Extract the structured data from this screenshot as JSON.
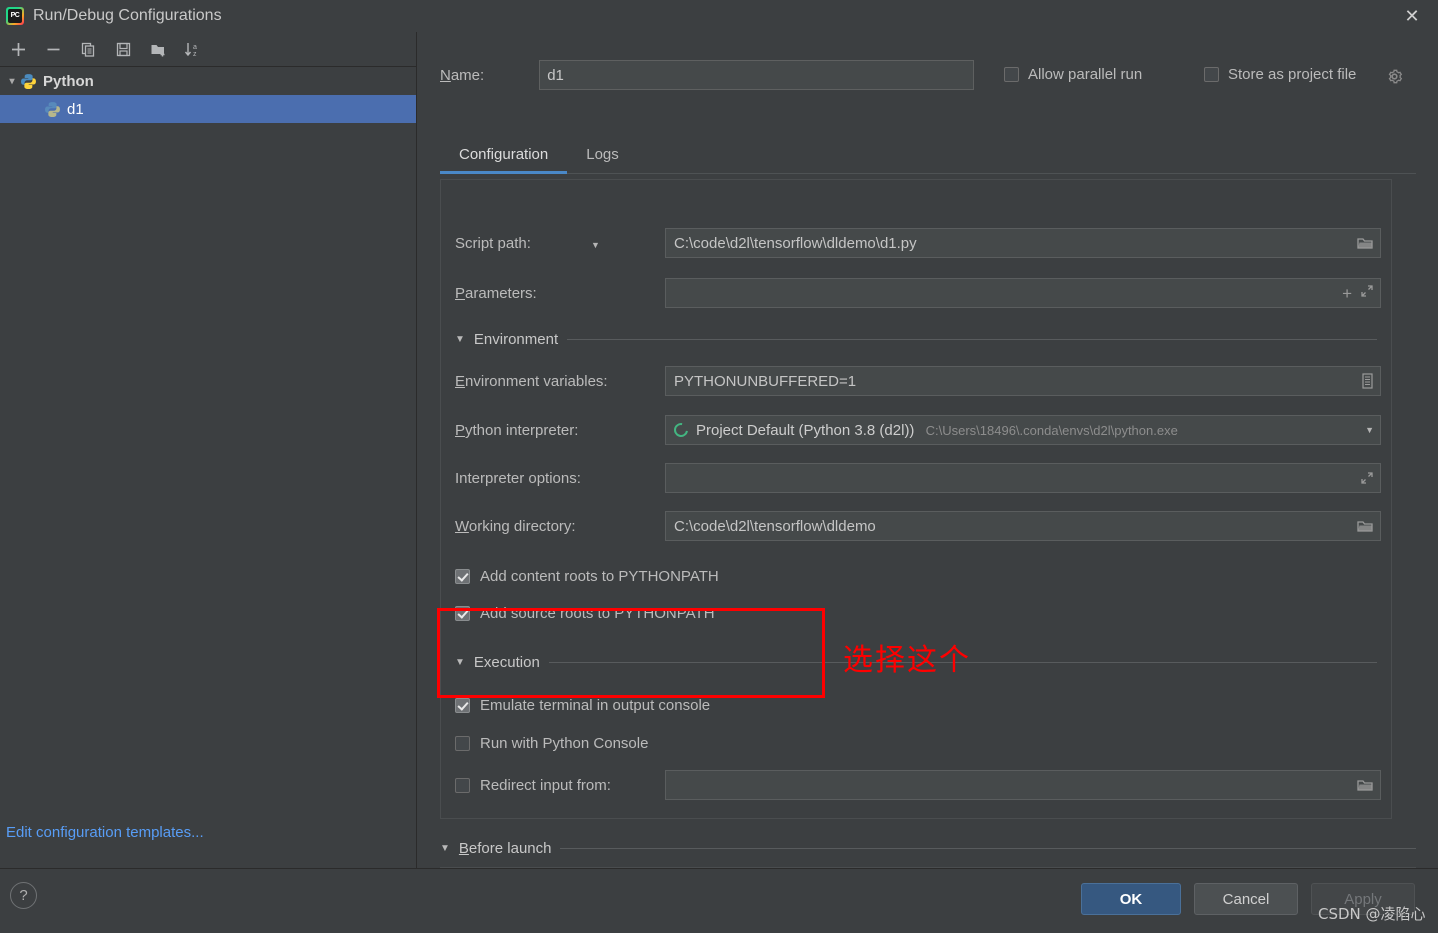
{
  "window": {
    "title": "Run/Debug Configurations",
    "app_icon": "pycharm-icon",
    "close_label": "✕"
  },
  "left_panel": {
    "toolbar": [
      {
        "name": "add-configuration-button",
        "icon": "plus-icon",
        "label": "+"
      },
      {
        "name": "remove-configuration-button",
        "icon": "minus-icon",
        "label": "−"
      },
      {
        "name": "copy-configuration-button",
        "icon": "copy-icon",
        "label": "Copy"
      },
      {
        "name": "save-configuration-button",
        "icon": "save-icon",
        "label": "Save"
      },
      {
        "name": "move-into-folder-button",
        "icon": "folder-add-icon",
        "label": "New Folder"
      },
      {
        "name": "sort-configurations-button",
        "icon": "sort-az-icon",
        "label": "Sort"
      }
    ],
    "tree": [
      {
        "label": "Python",
        "type": "group",
        "expanded": true,
        "icon": "python-icon"
      },
      {
        "label": "d1",
        "type": "item",
        "selected": true,
        "icon": "python-icon"
      }
    ],
    "edit_templates_link": "Edit configuration templates..."
  },
  "header": {
    "name_label": "Name:",
    "name_value": "d1",
    "name_placeholder": "",
    "allow_parallel_run": {
      "label": "Allow parallel run",
      "checked": false
    },
    "store_as_project_file": {
      "label": "Store as project file",
      "checked": false
    },
    "gear_icon": "gear-icon"
  },
  "tabs": [
    {
      "label": "Configuration",
      "active": true
    },
    {
      "label": "Logs",
      "active": false
    }
  ],
  "form": {
    "script_path": {
      "label": "Script path:",
      "value": "C:\\code\\d2l\\tensorflow\\dldemo\\d1.py",
      "has_dropdown": true,
      "trailing_icon": "folder-open-icon"
    },
    "parameters": {
      "label": "Parameters:",
      "value": "",
      "trailing_icons": [
        "plus-icon",
        "expand-icon"
      ]
    },
    "environment_section": {
      "label": "Environment",
      "expanded": true
    },
    "environment_variables": {
      "label": "Environment variables:",
      "value": "PYTHONUNBUFFERED=1",
      "trailing_icon": "browse-variables-icon"
    },
    "python_interpreter": {
      "label": "Python interpreter:",
      "value": "Project Default (Python 3.8 (d2l))",
      "path": "C:\\Users\\18496\\.conda\\envs\\d2l\\python.exe",
      "trailing_icon": "chevron-down-icon"
    },
    "interpreter_options": {
      "label": "Interpreter options:",
      "value": "",
      "trailing_icon": "expand-icon"
    },
    "working_directory": {
      "label": "Working directory:",
      "value": "C:\\code\\d2l\\tensorflow\\dldemo",
      "trailing_icon": "folder-open-icon"
    },
    "add_content_roots": {
      "label": "Add content roots to PYTHONPATH",
      "checked": true
    },
    "add_source_roots": {
      "label": "Add source roots to PYTHONPATH",
      "checked": true
    },
    "execution_section": {
      "label": "Execution",
      "expanded": true
    },
    "emulate_terminal": {
      "label": "Emulate terminal in output console",
      "checked": true
    },
    "run_with_python_console": {
      "label": "Run with Python Console",
      "checked": false
    },
    "redirect_input_from": {
      "label": "Redirect input from:",
      "checked": false,
      "value": "",
      "trailing_icon": "folder-open-icon"
    }
  },
  "before_launch": {
    "label": "Before launch",
    "expanded": true,
    "toolbar": [
      "plus-icon",
      "minus-icon",
      "edit-icon",
      "up-icon",
      "down-icon"
    ]
  },
  "footer": {
    "help_label": "?",
    "ok_label": "OK",
    "cancel_label": "Cancel",
    "apply_label": "Apply",
    "apply_disabled": true
  },
  "annotation": {
    "note_text": "选择这个",
    "note_color": "#ff0000",
    "highlight_target": "emulate-terminal-checkbox"
  },
  "watermark": {
    "text": "CSDN @凌陷心"
  },
  "colors": {
    "background": "#3c3f41",
    "selection": "#4b6eaf",
    "accent": "#4a88c7",
    "link": "#589df6",
    "primary_button": "#365880",
    "annotation": "#ff0000"
  }
}
